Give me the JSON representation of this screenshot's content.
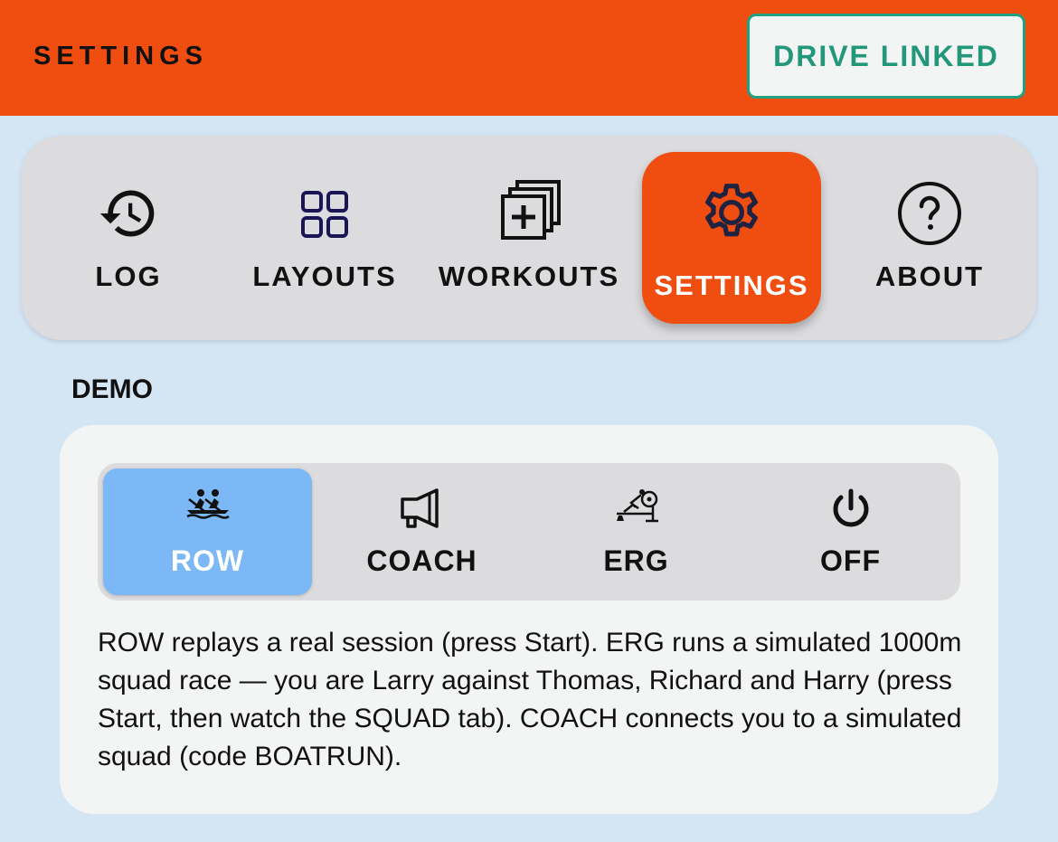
{
  "appbar": {
    "title": "SETTINGS",
    "drive_button": "DRIVE LINKED",
    "color": "#f04e11"
  },
  "nav": {
    "items": [
      {
        "label": "LOG",
        "icon": "history-icon",
        "active": false
      },
      {
        "label": "LAYOUTS",
        "icon": "grid-icon",
        "active": false
      },
      {
        "label": "WORKOUTS",
        "icon": "library-add-icon",
        "active": false
      },
      {
        "label": "SETTINGS",
        "icon": "gear-icon",
        "active": true
      },
      {
        "label": "ABOUT",
        "icon": "help-circle-icon",
        "active": false
      }
    ]
  },
  "demo": {
    "title": "DEMO",
    "options": [
      {
        "label": "ROW",
        "icon": "rowing-icon",
        "selected": true
      },
      {
        "label": "COACH",
        "icon": "megaphone-icon",
        "selected": false
      },
      {
        "label": "ERG",
        "icon": "rowing-machine-icon",
        "selected": false
      },
      {
        "label": "OFF",
        "icon": "power-icon",
        "selected": false
      }
    ],
    "description": "ROW replays a real session (press Start). ERG runs a simulated 1000m squad race — you are Larry against Thomas, Richard and Harry (press Start, then watch the SQUAD tab). COACH connects you to a simulated squad (code BOATRUN).",
    "selected_color": "#7cb8f6"
  }
}
